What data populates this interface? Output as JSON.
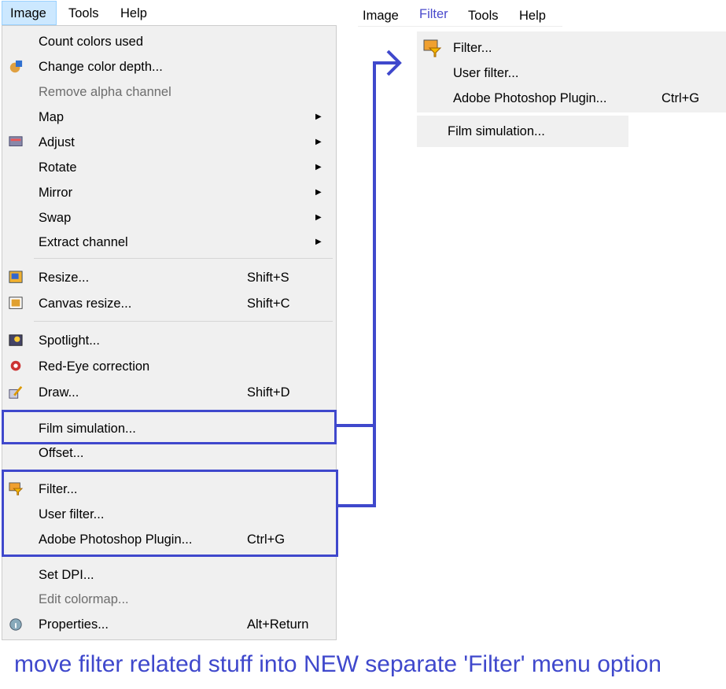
{
  "left_menubar": {
    "items": [
      "Image",
      "Tools",
      "Help"
    ]
  },
  "image_menu": {
    "items": [
      {
        "label": "Count colors used"
      },
      {
        "label": "Change color depth...",
        "icon": "color-depth-icon"
      },
      {
        "label": "Remove alpha channel",
        "disabled": true
      },
      {
        "label": "Map",
        "submenu": true
      },
      {
        "label": "Adjust",
        "submenu": true,
        "icon": "adjust-icon"
      },
      {
        "label": "Rotate",
        "submenu": true
      },
      {
        "label": "Mirror",
        "submenu": true
      },
      {
        "label": "Swap",
        "submenu": true
      },
      {
        "label": "Extract channel",
        "submenu": true
      },
      {
        "label": "Resize...",
        "shortcut": "Shift+S",
        "icon": "resize-icon"
      },
      {
        "label": "Canvas resize...",
        "shortcut": "Shift+C",
        "icon": "canvas-icon"
      },
      {
        "label": "Spotlight...",
        "icon": "spotlight-icon"
      },
      {
        "label": "Red-Eye correction",
        "icon": "red-eye-icon"
      },
      {
        "label": "Draw...",
        "shortcut": "Shift+D",
        "icon": "draw-icon"
      },
      {
        "label": "Film simulation..."
      },
      {
        "label": "Offset..."
      },
      {
        "label": "Filter...",
        "icon": "filter-icon"
      },
      {
        "label": "User filter..."
      },
      {
        "label": "Adobe Photoshop Plugin...",
        "shortcut": "Ctrl+G"
      },
      {
        "label": "Set DPI..."
      },
      {
        "label": "Edit colormap...",
        "disabled": true
      },
      {
        "label": "Properties...",
        "shortcut": "Alt+Return",
        "icon": "properties-icon"
      }
    ]
  },
  "right_menubar": {
    "items": [
      "Image",
      "Filter",
      "Tools",
      "Help"
    ]
  },
  "filter_menu": {
    "items": [
      {
        "label": "Filter...",
        "icon": "filter-icon"
      },
      {
        "label": "User filter..."
      },
      {
        "label": "Adobe Photoshop Plugin...",
        "shortcut": "Ctrl+G"
      }
    ],
    "film": "Film simulation..."
  },
  "caption": "move filter related stuff into NEW separate 'Filter' menu option",
  "colors": {
    "annotation": "#3f48cc",
    "menu_bg": "#f0f0f0"
  }
}
